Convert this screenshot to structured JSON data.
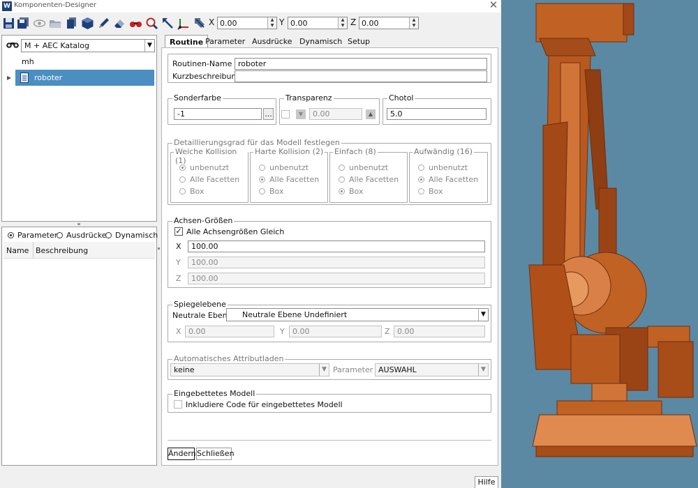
{
  "window": {
    "title": "Komponenten-Designer",
    "close_glyph": "✕",
    "app_glyph": "W"
  },
  "toolbar": {
    "icons": [
      "save-icon",
      "save-all-icon",
      "eye-icon",
      "open-folder-icon",
      "copy-icon",
      "cube-icon",
      "pencil-icon",
      "eraser-icon",
      "binoculars-red-icon",
      "zoom-icon",
      "move-arrow-icon",
      "axes-icon",
      "rotate-arrow-icon"
    ],
    "x_label": "X",
    "x_value": "0.00",
    "y_label": "Y",
    "y_value": "0.00",
    "z_label": "Z",
    "z_value": "0.00"
  },
  "left": {
    "catalog_select": "M + AEC Katalog",
    "tree_root": "mh",
    "tree_item": "roboter",
    "radio_parameter": "Parameter",
    "radio_ausdruecke": "Ausdrücke",
    "radio_dynamisch": "Dynamisch",
    "col_name": "Name",
    "col_beschreibung": "Beschreibung"
  },
  "tabs": [
    "Routine",
    "Parameter",
    "Ausdrücke",
    "Dynamisch",
    "Setup"
  ],
  "routine": {
    "name_label": "Routinen-Name",
    "name_value": "roboter",
    "kurz_label": "Kurzbeschreibung",
    "kurz_value": ""
  },
  "sonderfarbe": {
    "label": "Sonderfarbe",
    "value": "-1",
    "btn": "..."
  },
  "transparenz": {
    "label": "Transparenz",
    "value": "0.00"
  },
  "chotol": {
    "label": "Chotol",
    "value": "5.0"
  },
  "detail": {
    "label": "Detaillierungsgrad für das Modell festlegen",
    "groups": [
      {
        "title": "Weiche Kollision (1)",
        "selected": 0
      },
      {
        "title": "Harte Kollision (2)",
        "selected": 1
      },
      {
        "title": "Einfach (8)",
        "selected": 2
      },
      {
        "title": "Aufwändig (16)",
        "selected": 1
      }
    ],
    "options": [
      "unbenutzt",
      "Alle Facetten",
      "Box"
    ]
  },
  "achsen": {
    "label": "Achsen-Größen",
    "check_label": "Alle Achsengrößen Gleich",
    "check_mark": "✓",
    "x_label": "X",
    "x_value": "100.00",
    "y_label": "Y",
    "y_value": "100.00",
    "z_label": "Z",
    "z_value": "100.00"
  },
  "spiegel": {
    "label": "Spiegelebene",
    "neutral_label": "Neutrale Ebene",
    "neutral_value": "Neutrale Ebene Undefiniert",
    "x_label": "X",
    "x_value": "0.00",
    "y_label": "Y",
    "y_value": "0.00",
    "z_label": "Z",
    "z_value": "0.00"
  },
  "auto": {
    "label": "Automatisches Attributladen",
    "select_value": "keine",
    "param_label": "Parameter",
    "param_value": "AUSWAHL"
  },
  "eingebettet": {
    "label": "Eingebettetes Modell",
    "check_label": "Inkludiere Code für eingebettetes Modell"
  },
  "buttons": {
    "aendern": "Ändern",
    "schliessen": "Schließen",
    "hilfe": "Hilfe"
  },
  "colors": {
    "robot": "#b5541e",
    "background_3d": "#5b89a3",
    "selection": "#4a8ec2"
  }
}
